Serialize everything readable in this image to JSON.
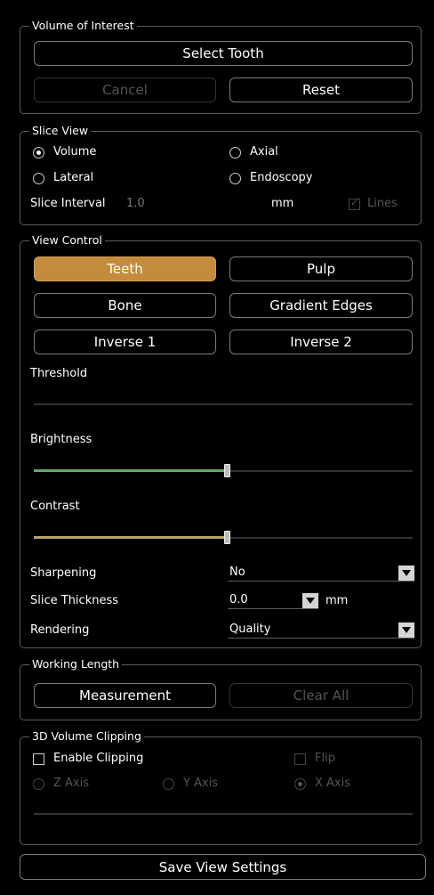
{
  "voi": {
    "legend": "Volume of Interest",
    "select_tooth": "Select Tooth",
    "cancel": "Cancel",
    "reset": "Reset"
  },
  "slice_view": {
    "legend": "Slice View",
    "options": [
      "Volume",
      "Axial",
      "Lateral",
      "Endoscopy"
    ],
    "selected": "Volume",
    "interval_label": "Slice Interval",
    "interval_value": "1.0",
    "interval_unit": "mm",
    "lines_label": "Lines",
    "lines_checked": true
  },
  "view_control": {
    "legend": "View Control",
    "buttons": [
      "Teeth",
      "Pulp",
      "Bone",
      "Gradient Edges",
      "Inverse 1",
      "Inverse 2"
    ],
    "active": "Teeth",
    "threshold_label": "Threshold",
    "brightness_label": "Brightness",
    "brightness_level": 0.51,
    "brightness_color": "#6aa66a",
    "contrast_label": "Contrast",
    "contrast_level": 0.51,
    "contrast_color": "#b8a36a",
    "sharpening_label": "Sharpening",
    "sharpening_value": "No",
    "thickness_label": "Slice Thickness",
    "thickness_value": "0.0",
    "thickness_unit": "mm",
    "rendering_label": "Rendering",
    "rendering_value": "Quality"
  },
  "working_length": {
    "legend": "Working Length",
    "measurement": "Measurement",
    "clear_all": "Clear All"
  },
  "clipping": {
    "legend": "3D Volume Clipping",
    "enable_label": "Enable Clipping",
    "flip_label": "Flip",
    "z_axis": "Z Axis",
    "y_axis": "Y Axis",
    "x_axis": "X Axis",
    "selected_axis": "X Axis"
  },
  "footer": {
    "save": "Save View Settings"
  }
}
